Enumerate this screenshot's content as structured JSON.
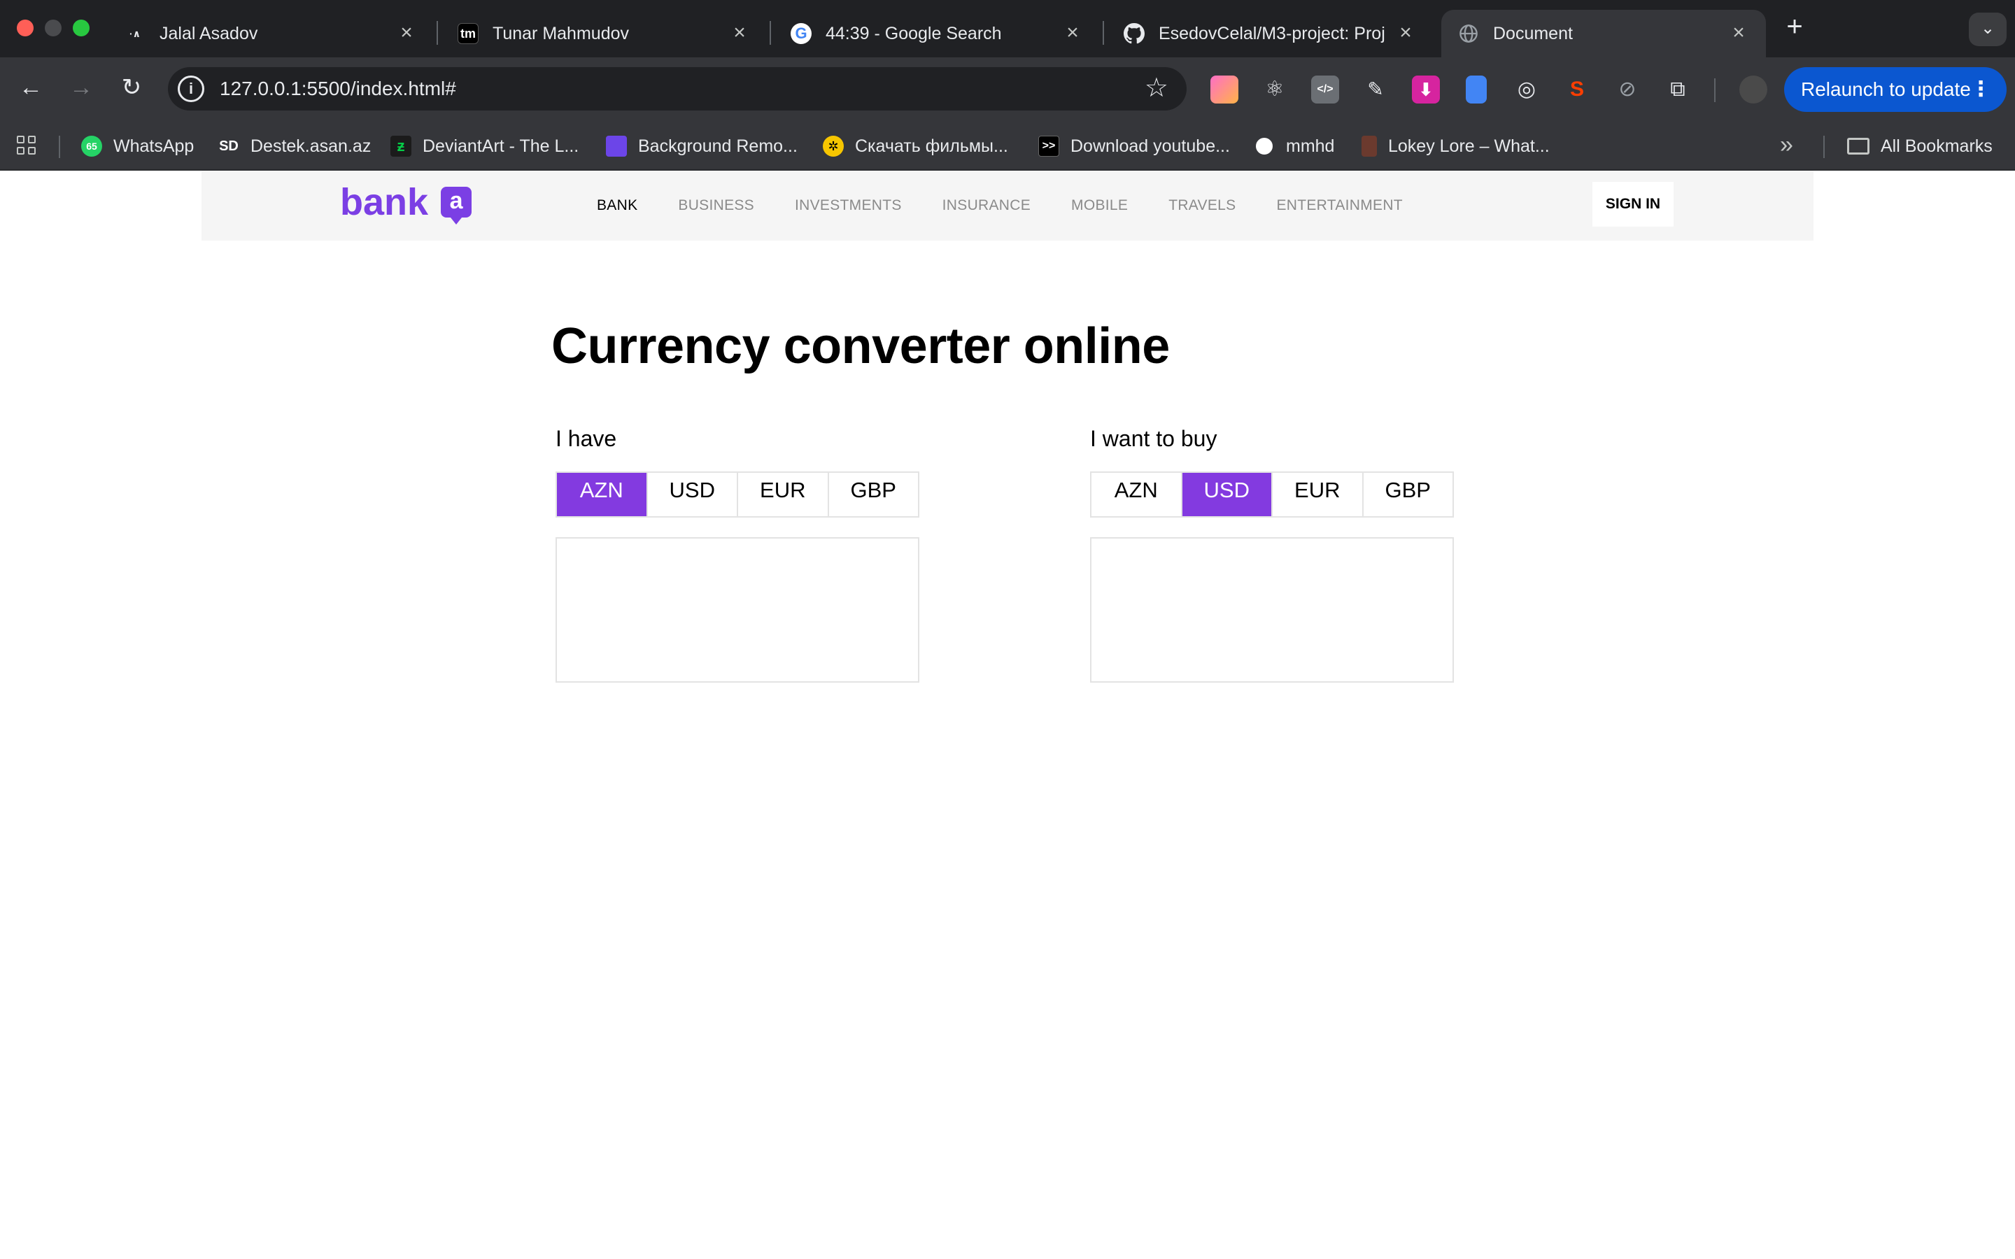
{
  "browser": {
    "tabs": [
      {
        "title": "Jalal Asadov",
        "favicon": "jalal-favicon",
        "active": false
      },
      {
        "title": "Tunar Mahmudov",
        "favicon": "tm-favicon",
        "favicon_text": "tm",
        "active": false
      },
      {
        "title": "44:39 - Google Search",
        "favicon": "google-icon",
        "favicon_text": "G",
        "active": false
      },
      {
        "title": "EsedovCelal/M3-project: Proj",
        "favicon": "github-icon",
        "active": false
      },
      {
        "title": "Document",
        "favicon": "globe-icon",
        "active": true
      }
    ],
    "url": "127.0.0.1:5500/index.html#",
    "relaunch_label": "Relaunch to update",
    "bookmarks": [
      {
        "label": "WhatsApp",
        "icon": "whatsapp-icon",
        "badge": "65",
        "color": "#25d366"
      },
      {
        "label": "Destek.asan.az",
        "icon": "sd-icon",
        "badge": "SD",
        "color": "#35363a"
      },
      {
        "label": "DeviantArt - The L...",
        "icon": "deviantart-icon",
        "color": "#05cc47"
      },
      {
        "label": "Background Remo...",
        "icon": "remove-bg-icon",
        "color": "#6c45e8"
      },
      {
        "label": "Скачать фильмы...",
        "icon": "film-icon",
        "color": "#f7c600"
      },
      {
        "label": "Download youtube...",
        "icon": "terminal-icon",
        "badge": ">>",
        "color": "#000000"
      },
      {
        "label": "mmhd",
        "icon": "mmhd-icon",
        "color": "#ffffff"
      },
      {
        "label": "Lokey Lore – What...",
        "icon": "lokey-icon",
        "color": "#6b3a2e"
      }
    ],
    "all_bookmarks_label": "All Bookmarks"
  },
  "site": {
    "brand": "bank",
    "brand_badge": "a",
    "nav": [
      "BANK",
      "BUSINESS",
      "INVESTMENTS",
      "INSURANCE",
      "MOBILE",
      "TRAVELS",
      "ENTERTAINMENT"
    ],
    "nav_active": "BANK",
    "signin_label": "SIGN IN",
    "accent_color": "#833ae0"
  },
  "converter": {
    "title": "Currency converter online",
    "have": {
      "label": "I have",
      "currencies": [
        "AZN",
        "USD",
        "EUR",
        "GBP"
      ],
      "selected": "AZN",
      "amount": ""
    },
    "want": {
      "label": "I want to buy",
      "currencies": [
        "AZN",
        "USD",
        "EUR",
        "GBP"
      ],
      "selected": "USD",
      "amount": ""
    }
  }
}
